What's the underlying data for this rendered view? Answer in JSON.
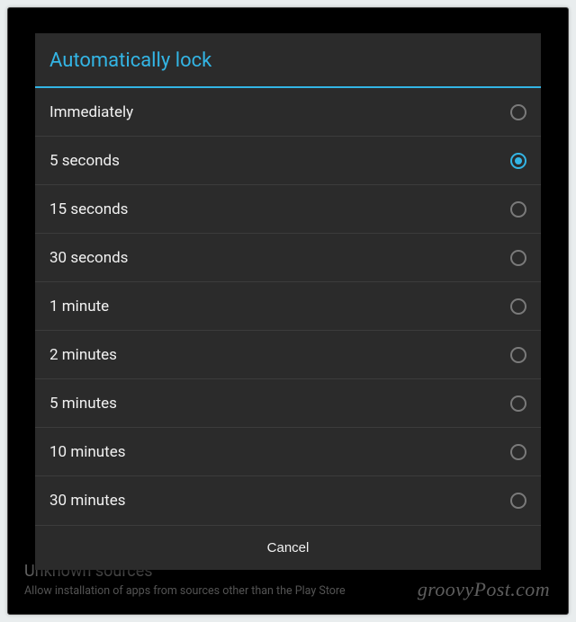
{
  "dialog": {
    "title": "Automatically lock",
    "options": [
      "Immediately",
      "5 seconds",
      "15 seconds",
      "30 seconds",
      "1 minute",
      "2 minutes",
      "5 minutes",
      "10 minutes",
      "30 minutes"
    ],
    "selected_index": 1,
    "cancel_label": "Cancel"
  },
  "backdrop": {
    "unknown_sources_title": "Unknown sources",
    "unknown_sources_subtitle": "Allow installation of apps from sources other than the Play Store"
  },
  "watermark": "groovyPost.com"
}
